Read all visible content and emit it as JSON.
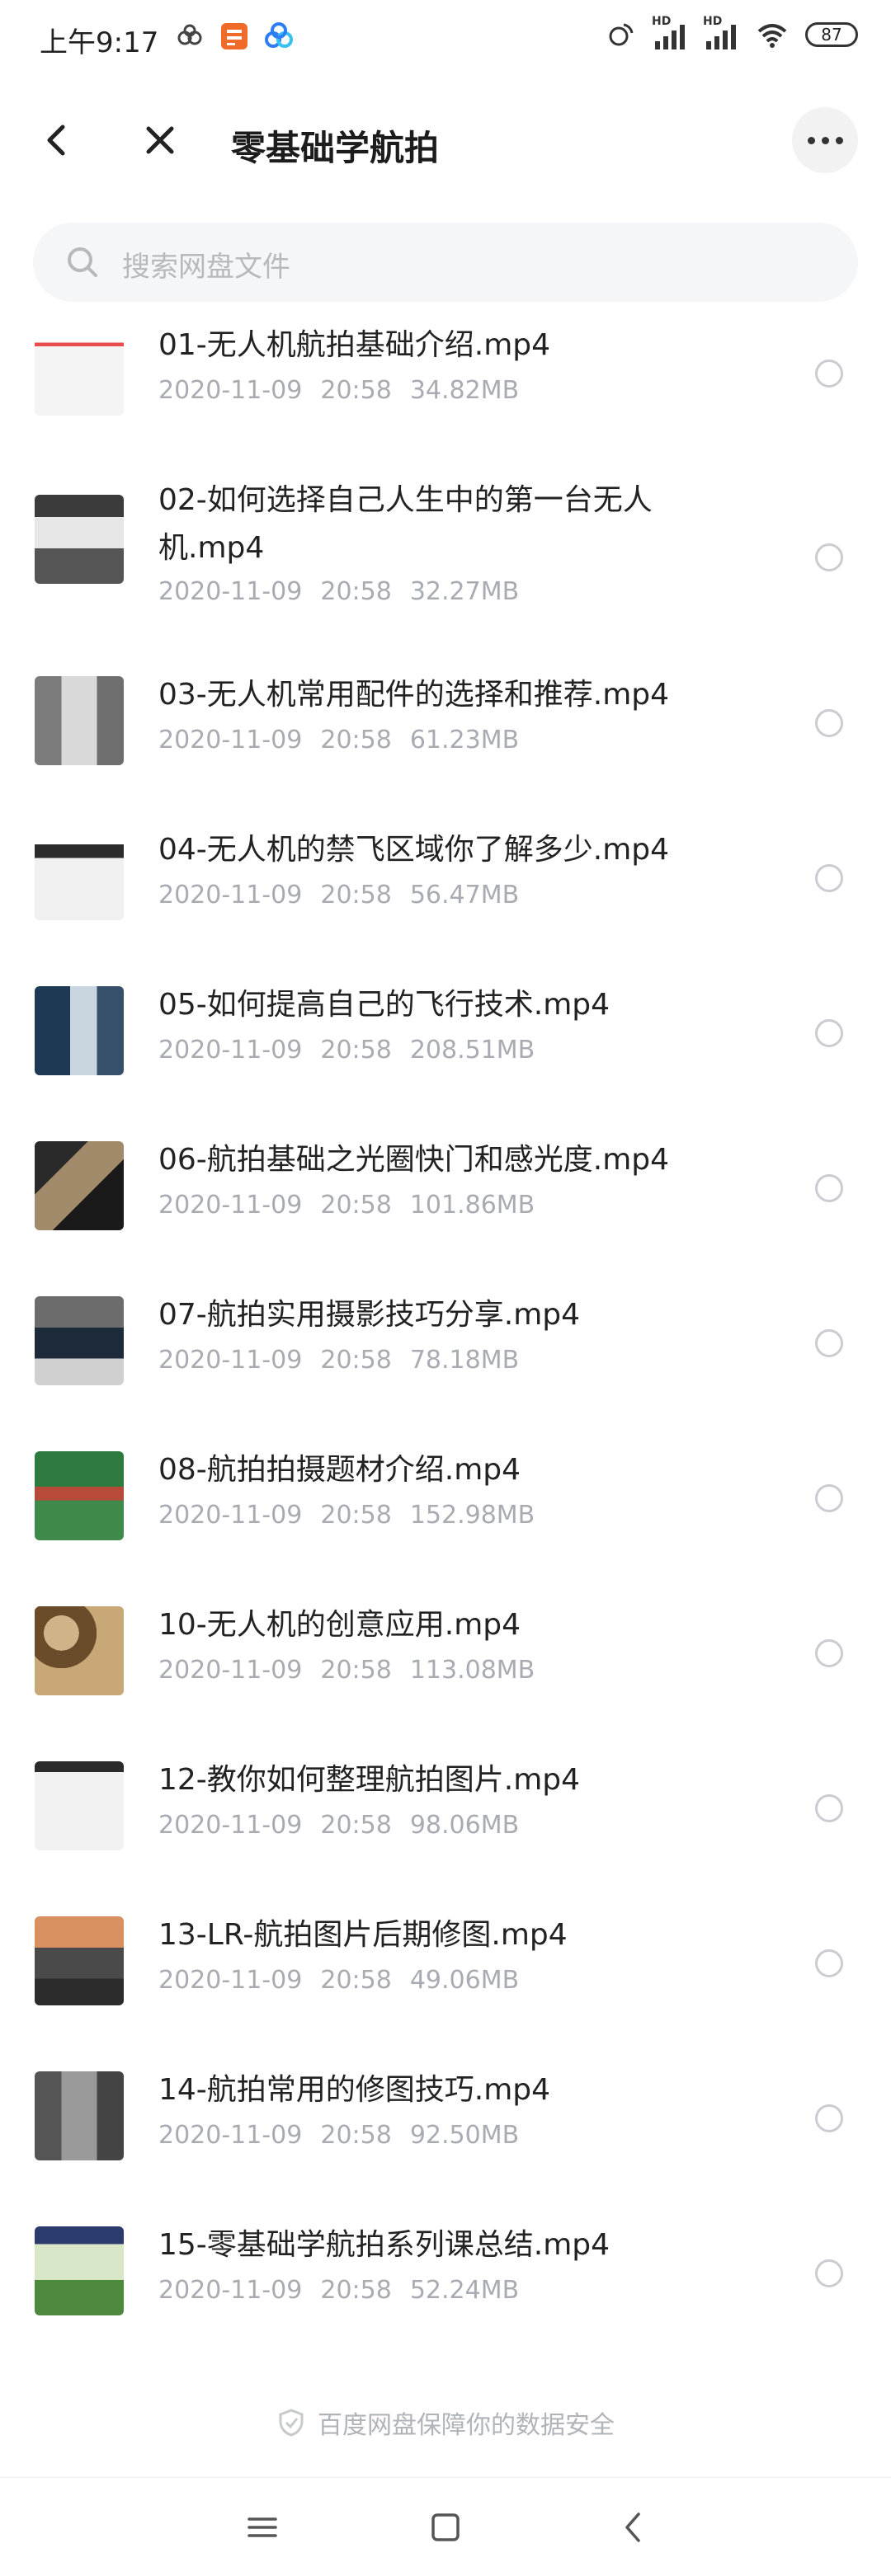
{
  "status_bar": {
    "time": "上午9:17",
    "signal_1_label": "HD",
    "signal_2_label": "HD",
    "battery": "87"
  },
  "header": {
    "title": "零基础学航拍"
  },
  "search": {
    "placeholder": "搜索网盘文件"
  },
  "files": [
    {
      "name": "01-无人机航拍基础介绍.mp4",
      "date": "2020-11-09",
      "time": "20:58",
      "size": "34.82MB"
    },
    {
      "name": "02-如何选择自己人生中的第一台无人机.mp4",
      "date": "2020-11-09",
      "time": "20:58",
      "size": "32.27MB"
    },
    {
      "name": "03-无人机常用配件的选择和推荐.mp4",
      "date": "2020-11-09",
      "time": "20:58",
      "size": "61.23MB"
    },
    {
      "name": "04-无人机的禁飞区域你了解多少.mp4",
      "date": "2020-11-09",
      "time": "20:58",
      "size": "56.47MB"
    },
    {
      "name": "05-如何提高自己的飞行技术.mp4",
      "date": "2020-11-09",
      "time": "20:58",
      "size": "208.51MB"
    },
    {
      "name": "06-航拍基础之光圈快门和感光度.mp4",
      "date": "2020-11-09",
      "time": "20:58",
      "size": "101.86MB"
    },
    {
      "name": "07-航拍实用摄影技巧分享.mp4",
      "date": "2020-11-09",
      "time": "20:58",
      "size": "78.18MB"
    },
    {
      "name": "08-航拍拍摄题材介绍.mp4",
      "date": "2020-11-09",
      "time": "20:58",
      "size": "152.98MB"
    },
    {
      "name": "10-无人机的创意应用.mp4",
      "date": "2020-11-09",
      "time": "20:58",
      "size": "113.08MB"
    },
    {
      "name": "12-教你如何整理航拍图片.mp4",
      "date": "2020-11-09",
      "time": "20:58",
      "size": "98.06MB"
    },
    {
      "name": "13-LR-航拍图片后期修图.mp4",
      "date": "2020-11-09",
      "time": "20:58",
      "size": "49.06MB"
    },
    {
      "name": "14-航拍常用的修图技巧.mp4",
      "date": "2020-11-09",
      "time": "20:58",
      "size": "92.50MB"
    },
    {
      "name": "15-零基础学航拍系列课总结.mp4",
      "date": "2020-11-09",
      "time": "20:58",
      "size": "52.24MB"
    }
  ],
  "footer": {
    "security_note": "百度网盘保障你的数据安全"
  },
  "icons": {
    "back": "back-arrow-icon",
    "close": "close-icon",
    "more": "more-icon",
    "search": "search-icon",
    "shield": "shield-icon",
    "nav_menu": "menu-icon",
    "nav_home": "home-icon",
    "nav_back": "nav-back-icon"
  },
  "colors": {
    "accent": "#2e7cf6",
    "meta_text": "#a8acb2",
    "search_bg": "#f5f6f8"
  }
}
